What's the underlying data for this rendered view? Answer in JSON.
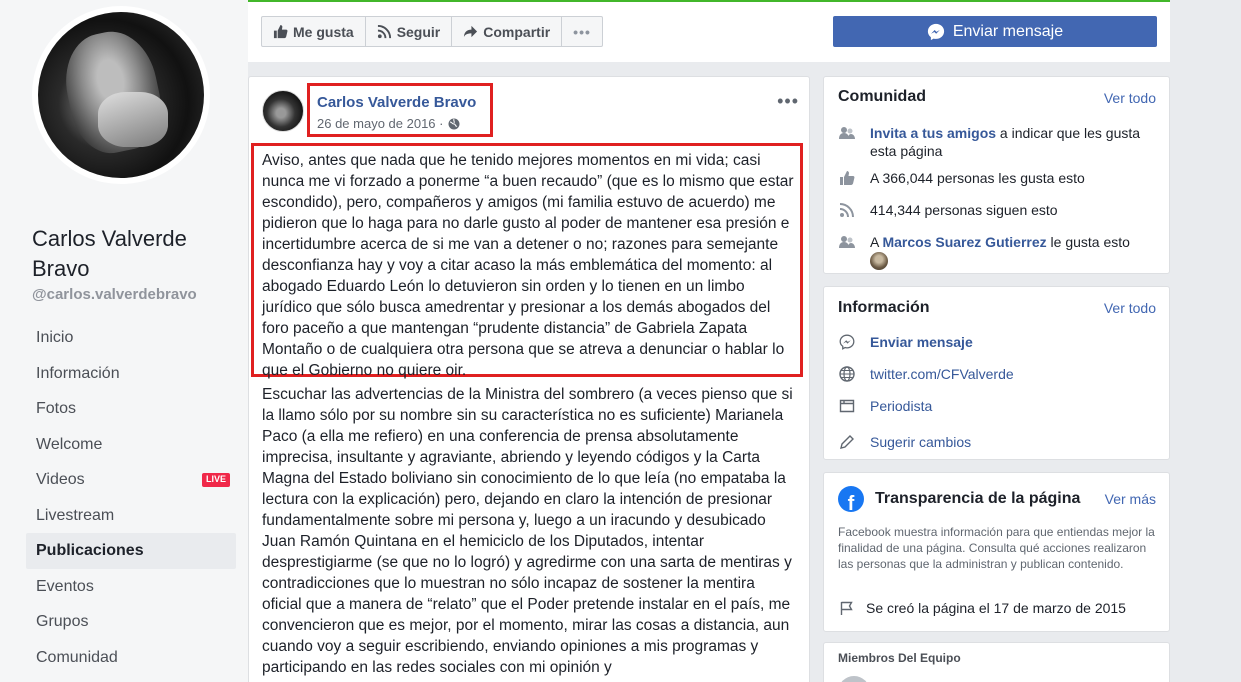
{
  "page": {
    "name": "Carlos Valverde Bravo",
    "handle": "@carlos.valverdebravo"
  },
  "nav": {
    "items": [
      {
        "label": "Inicio"
      },
      {
        "label": "Información"
      },
      {
        "label": "Fotos"
      },
      {
        "label": "Welcome"
      },
      {
        "label": "Videos",
        "badge": "LIVE"
      },
      {
        "label": "Livestream"
      },
      {
        "label": "Publicaciones",
        "active": true
      },
      {
        "label": "Eventos"
      },
      {
        "label": "Grupos"
      },
      {
        "label": "Comunidad"
      }
    ]
  },
  "toolbar": {
    "like_label": "Me gusta",
    "follow_label": "Seguir",
    "share_label": "Compartir",
    "more_label": "•••",
    "message_label": "Enviar mensaje"
  },
  "post": {
    "author": "Carlos Valverde Bravo",
    "date": "26 de mayo de 2016 ·",
    "more": "•••",
    "paragraph1": "Aviso, antes que nada que he tenido mejores momentos en mi vida; casi nunca me vi forzado a ponerme “a buen recaudo” (que es lo mismo que estar escondido), pero, compañeros y amigos (mi familia estuvo de acuerdo) me pidieron que lo haga para no darle gusto al poder de mantener esa presión e incertidumbre acerca de si me van a detener o no; razones para semejante desconfianza hay y voy a citar acaso la más emblemática del momento: al abogado Eduardo León lo detuvieron sin orden y lo tienen en un limbo jurídico que sólo busca amedrentar y presionar a los demás abogados del foro paceño a que mantengan “prudente distancia” de Gabriela Zapata Montaño o de cualquiera otra persona que se atreva a denunciar o hablar lo que el Gobierno no quiere oir.",
    "paragraph2": "Escuchar las advertencias de la Ministra del sombrero (a veces pienso que si la llamo sólo por su nombre sin su característica no es suficiente) Marianela Paco (a ella me refiero) en una conferencia de prensa absolutamente imprecisa, insultante y agraviante, abriendo y leyendo códigos y la Carta Magna del Estado boliviano sin conocimiento de lo que leía (no empataba la lectura con la explicación) pero, dejando en claro la intención de presionar fundamentalmente sobre mi persona y, luego a un iracundo y desubicado Juan Ramón Quintana en el hemiciclo de los Diputados, intentar desprestigiarme (se que no lo logró) y agredirme con una sarta de mentiras y contradicciones que lo muestran no sólo incapaz de sostener la mentira oficial que a manera de “relato” que el Poder pretende instalar en el país, me convencieron que es mejor, por el momento, mirar las cosas a distancia, aun cuando voy a seguir escribiendo, enviando opiniones a mis programas y participando en las redes sociales con mi opinión y"
  },
  "community": {
    "title": "Comunidad",
    "see_all": "Ver todo",
    "invite_link": "Invita a tus amigos",
    "invite_rest": " a indicar que les gusta esta página",
    "likes": "A 366,044 personas les gusta esto",
    "follows": "414,344 personas siguen esto",
    "friend_prefix": "A ",
    "friend_name": "Marcos Suarez Gutierrez",
    "friend_suffix": " le gusta esto"
  },
  "info": {
    "title": "Información",
    "see_all": "Ver todo",
    "send_message": "Enviar mensaje",
    "twitter": "twitter.com/CFValverde",
    "category": "Periodista",
    "suggest": "Sugerir cambios"
  },
  "transparency": {
    "title": "Transparencia de la página",
    "see_more": "Ver más",
    "description": "Facebook muestra información para que entiendas mejor la finalidad de una página. Consulta qué acciones realizaron las personas que la administran y publican contenido.",
    "created": "Se creó la página el 17 de marzo de 2015"
  },
  "team": {
    "title": "Miembros Del Equipo"
  },
  "colors": {
    "brand_blue": "#4267b2",
    "link_blue": "#365899",
    "highlight_red": "#e02020",
    "live_red": "#f02849"
  }
}
